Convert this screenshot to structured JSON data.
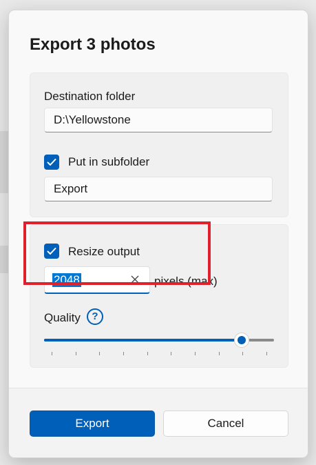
{
  "dialog": {
    "title": "Export 3 photos"
  },
  "destination": {
    "label": "Destination folder",
    "value": "D:\\Yellowstone"
  },
  "subfolder": {
    "checkbox_label": "Put in subfolder",
    "checked": true,
    "value": "Export"
  },
  "resize": {
    "checkbox_label": "Resize output",
    "checked": true,
    "value": "2048",
    "unit": "pixels (max)"
  },
  "quality": {
    "label": "Quality",
    "help_glyph": "?",
    "level": 0.86,
    "tick_count": 10
  },
  "footer": {
    "export_label": "Export",
    "cancel_label": "Cancel"
  },
  "colors": {
    "accent": "#005fb8",
    "highlight": "#e0202a"
  },
  "icons": {
    "checkbox": "checkmark-icon",
    "clear": "close-icon",
    "help": "question-circle-icon"
  }
}
